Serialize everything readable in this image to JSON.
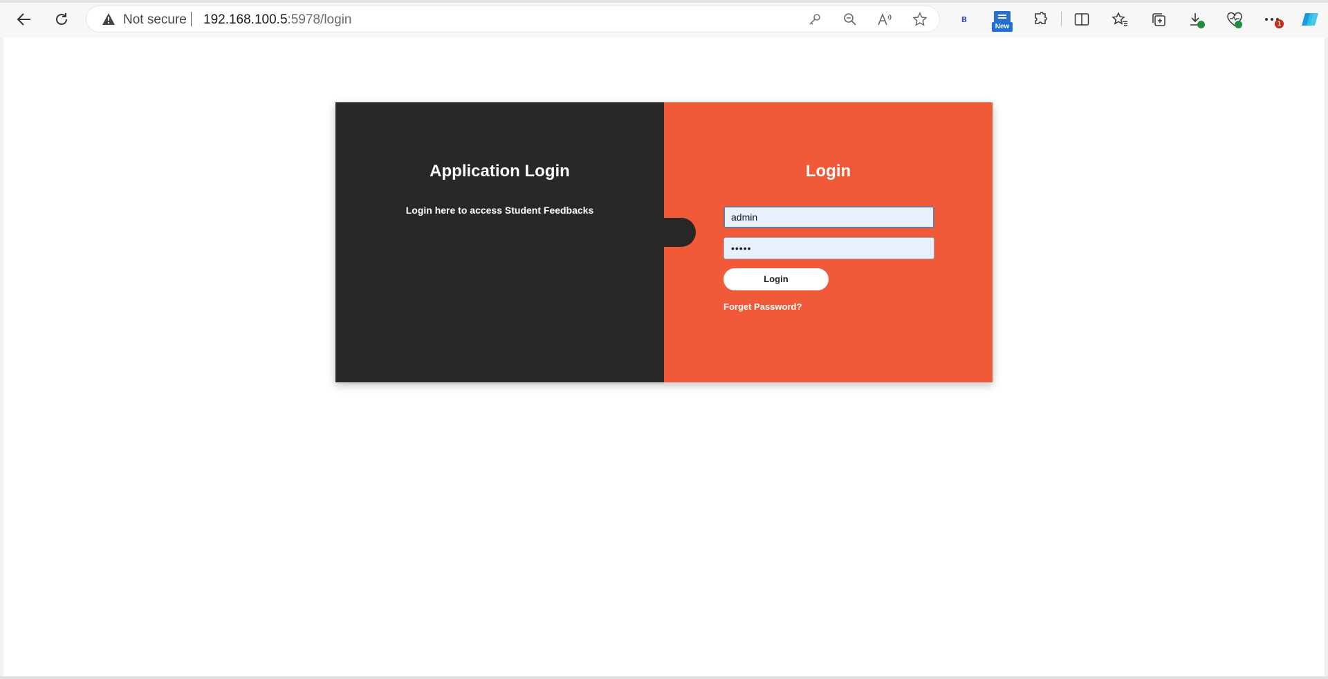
{
  "browser": {
    "security_label": "Not secure",
    "url_host": "192.168.100.5",
    "url_rest": ":5978/login",
    "address_icons": [
      "key-icon",
      "zoom-out-icon",
      "read-aloud-icon",
      "favorite-star-icon"
    ],
    "toolbar_icons": [
      "bing-icon",
      "new-extension-icon",
      "extensions-icon",
      "split-screen-icon",
      "favorites-icon",
      "collections-icon",
      "downloads-icon",
      "browser-essentials-icon",
      "more-menu-icon",
      "copilot-icon"
    ],
    "bing_letter": "B",
    "new_badge": "New",
    "notification_count": "1"
  },
  "left_panel": {
    "title": "Application Login",
    "subtitle": "Login here to access Student Feedbacks",
    "color": "#292827"
  },
  "right_panel": {
    "title": "Login",
    "username_value": "admin",
    "password_value": "•••••",
    "login_button": "Login",
    "forget_link": "Forget Password?",
    "color": "#f05a38"
  }
}
